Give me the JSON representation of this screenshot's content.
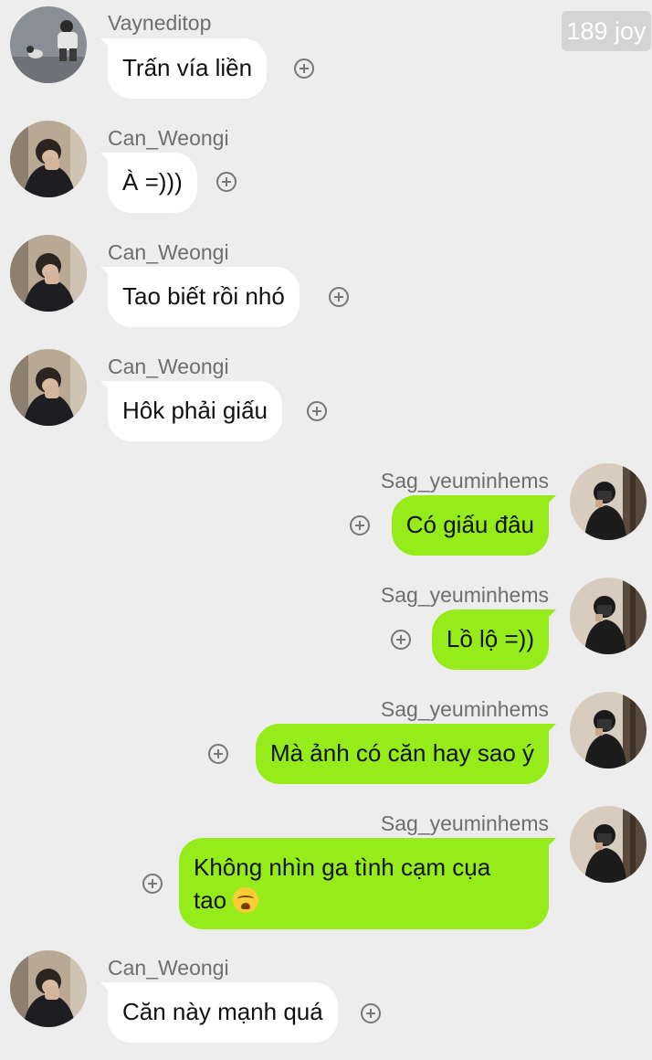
{
  "badge": "189 joy",
  "messages": [
    {
      "sender": "Vayneditop",
      "text": "Trấn vía liền",
      "side": "in",
      "avatar": "avatar-vayneditop"
    },
    {
      "sender": "Can_Weongi",
      "text": "À =)))",
      "side": "in",
      "avatar": "avatar-can-weongi"
    },
    {
      "sender": "Can_Weongi",
      "text": "Tao biết rồi nhó",
      "side": "in",
      "avatar": "avatar-can-weongi"
    },
    {
      "sender": "Can_Weongi",
      "text": "Hôk phải giấu",
      "side": "in",
      "avatar": "avatar-can-weongi"
    },
    {
      "sender": "Sag_yeuminhems",
      "text": "Có giấu đâu",
      "side": "out",
      "avatar": "avatar-sag-yeuminhems"
    },
    {
      "sender": "Sag_yeuminhems",
      "text": "Lồ lộ =))",
      "side": "out",
      "avatar": "avatar-sag-yeuminhems"
    },
    {
      "sender": "Sag_yeuminhems",
      "text": "Mà ảnh có căn hay sao ý",
      "side": "out",
      "avatar": "avatar-sag-yeuminhems"
    },
    {
      "sender": "Sag_yeuminhems",
      "text_line1": "Không nhìn ga tình cạm cụa",
      "text_line2": "tao",
      "emoji": "crying-face-emoji",
      "side": "out",
      "avatar": "avatar-sag-yeuminhems"
    },
    {
      "sender": "Can_Weongi",
      "text": "Căn này mạnh quá",
      "side": "in",
      "avatar": "avatar-can-weongi"
    }
  ],
  "colors": {
    "background": "#ededed",
    "incoming_bubble": "#ffffff",
    "outgoing_bubble": "#95ec1a",
    "name_text": "#6e6e6e"
  }
}
